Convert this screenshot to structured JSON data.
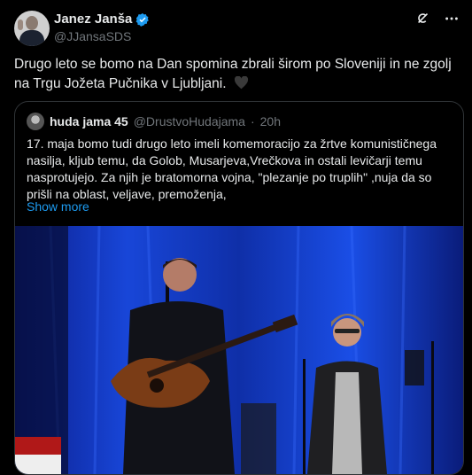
{
  "author": {
    "name": "Janez Janša",
    "handle": "@JJansaSDS"
  },
  "tweet": {
    "text": "Drugo leto se bomo na Dan spomina zbrali širom po Sloveniji in ne zgolj na Trgu Jožeta Pučnika v Ljubljani."
  },
  "icons": [
    "verified-badge-icon",
    "grok-icon",
    "more-icon",
    "black-heart-icon"
  ],
  "colors": {
    "accent": "#1d9bf0",
    "text": "#e7e9ea",
    "muted": "#71767b",
    "border": "#2f3336"
  },
  "quote": {
    "name": "huda jama 45",
    "handle": "@DrustvoHudajama",
    "dot": "·",
    "time": "20h",
    "text_lines": [
      "17. maja  bomo   tudi drugo leto imeli komemoracijo za žrtve komunističnega",
      "nasilja, kljub temu, da Golob, Musarjeva,Vrečkova in ostali levičarji  temu",
      "nasprotujejo. Za njih  je bratomorna vojna, \"plezanje po truplih\" ,nuja da so",
      "prišli na oblast, veljave, premoženja,"
    ],
    "show_more": "Show more"
  }
}
